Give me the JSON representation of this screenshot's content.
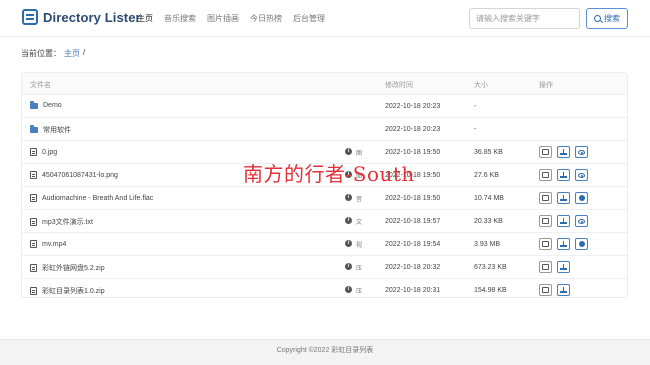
{
  "brand": {
    "name": "Directory Lister"
  },
  "nav": [
    {
      "label": "主页",
      "active": true
    },
    {
      "label": "音乐搜索",
      "active": false
    },
    {
      "label": "图片插画",
      "active": false
    },
    {
      "label": "今日热榜",
      "active": false
    },
    {
      "label": "后台管理",
      "active": false
    }
  ],
  "search": {
    "placeholder": "请输入搜索关键字",
    "button_label": "搜索"
  },
  "breadcrumb": {
    "prefix": "当前位置：",
    "home": "主页",
    "separator": "/"
  },
  "table": {
    "headers": {
      "name": "文件名",
      "modified": "修改时间",
      "size": "大小",
      "actions": "操作"
    },
    "rows": [
      {
        "type": "folder",
        "name": "Demo",
        "modified": "2022-10-18 20:23",
        "size": "-",
        "info": false,
        "view": "",
        "actions": []
      },
      {
        "type": "folder",
        "name": "常用软件",
        "modified": "2022-10-18 20:23",
        "size": "-",
        "info": false,
        "view": "",
        "actions": []
      },
      {
        "type": "file",
        "name": "0.jpg",
        "modified": "2022-10-18 19:50",
        "size": "36.85 KB",
        "info": true,
        "view": "图",
        "actions": [
          "copy",
          "download",
          "eye"
        ]
      },
      {
        "type": "file",
        "name": "45047061087431-lo.png",
        "modified": "2022-10-18 19:50",
        "size": "27.6 KB",
        "info": true,
        "view": "图",
        "actions": [
          "copy",
          "download",
          "eye"
        ]
      },
      {
        "type": "file",
        "name": "Audiomachine - Breath And Life.flac",
        "modified": "2022-10-18 19:50",
        "size": "10.74 MB",
        "info": true,
        "view": "音",
        "actions": [
          "copy",
          "download",
          "play"
        ]
      },
      {
        "type": "file",
        "name": "mp3文件演示.txt",
        "modified": "2022-10-18 19:57",
        "size": "20.33 KB",
        "info": true,
        "view": "文",
        "actions": [
          "copy",
          "download",
          "eye"
        ]
      },
      {
        "type": "file",
        "name": "mv.mp4",
        "modified": "2022-10-18 19:54",
        "size": "3.93 MB",
        "info": true,
        "view": "视",
        "actions": [
          "copy",
          "download",
          "play"
        ]
      },
      {
        "type": "file",
        "name": "彩虹外链网盘5.2.zip",
        "modified": "2022-10-18 20:32",
        "size": "673.23 KB",
        "info": true,
        "view": "压",
        "actions": [
          "copy",
          "download"
        ]
      },
      {
        "type": "file",
        "name": "彩虹目录列表1.0.zip",
        "modified": "2022-10-18 20:31",
        "size": "154.98 KB",
        "info": true,
        "view": "压",
        "actions": [
          "copy",
          "download"
        ]
      }
    ]
  },
  "watermark": "南方的行者-South",
  "footer": {
    "text": "Copyright ©2022 彩虹目录列表"
  },
  "colors": {
    "accent": "#2b6cb0",
    "watermark": "#e0303a"
  }
}
